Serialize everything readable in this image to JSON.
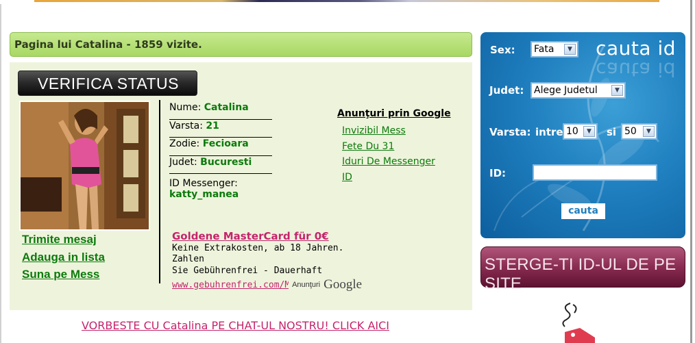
{
  "title_bar": {
    "text": "Pagina lui Catalina - 1859 vizite."
  },
  "verifica": {
    "label": "VERIFICA STATUS"
  },
  "profile": {
    "fields": [
      {
        "label": "Nume: ",
        "value": "Catalina"
      },
      {
        "label": "Varsta: ",
        "value": "21"
      },
      {
        "label": "Zodie: ",
        "value": "Fecioara"
      },
      {
        "label": "Judet: ",
        "value": "Bucuresti"
      }
    ],
    "messenger_label": "ID Messenger:",
    "messenger_value": "katty_manea",
    "actions": [
      "Trimite mesaj",
      "Adauga in lista",
      "Suna pe Mess"
    ]
  },
  "google_links": {
    "heading": "Anunţuri prin Google",
    "links": [
      "Invizibil Mess",
      "Fete Du 31",
      "Iduri De Messenger",
      "ID"
    ]
  },
  "google_ad": {
    "title": "Goldene MasterCard für 0€",
    "desc_line1": "Keine Extrakosten, ab 18 Jahren. Zahlen",
    "desc_line2": "Sie Gebührenfrei - Dauerhaft",
    "url": "www.gebuhrenfrei.com/Ma",
    "byline": "Anunţuri",
    "brand": "Google"
  },
  "chat_link": "VORBESTE CU Catalina PE CHAT-UL NOSTRU! CLICK AICI",
  "search": {
    "logo": "cauta id",
    "sex_label": "Sex:",
    "sex_value": "Fata",
    "judet_label": "Judet:",
    "judet_value": "Alege Judetul",
    "varsta_label": "Varsta:",
    "intre_label": "intre",
    "min_age": "10",
    "si_label": "si",
    "max_age": "50",
    "id_label": "ID:",
    "id_value": "",
    "button": "cauta"
  },
  "sterge_banner": "STERGE-TI ID-UL DE PE SITE",
  "colors": {
    "green_link": "#0c7a0c",
    "magenta_link": "#c4246c",
    "search_blue": "#1f7fbf",
    "banner_plum": "#8a2c52",
    "title_green": "#a8d863"
  }
}
